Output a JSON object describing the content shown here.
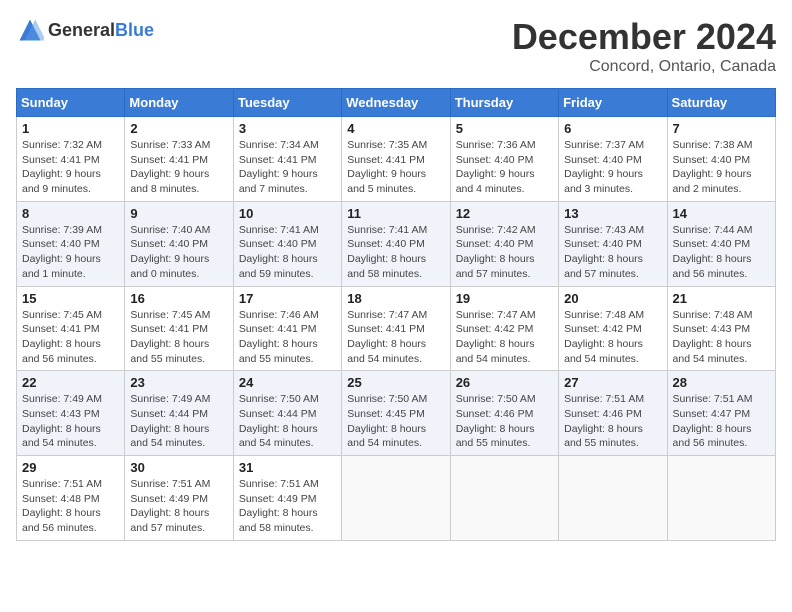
{
  "header": {
    "logo_general": "General",
    "logo_blue": "Blue",
    "month_title": "December 2024",
    "location": "Concord, Ontario, Canada"
  },
  "days_of_week": [
    "Sunday",
    "Monday",
    "Tuesday",
    "Wednesday",
    "Thursday",
    "Friday",
    "Saturday"
  ],
  "weeks": [
    [
      {
        "day": "1",
        "sunrise": "7:32 AM",
        "sunset": "4:41 PM",
        "daylight": "9 hours and 9 minutes."
      },
      {
        "day": "2",
        "sunrise": "7:33 AM",
        "sunset": "4:41 PM",
        "daylight": "9 hours and 8 minutes."
      },
      {
        "day": "3",
        "sunrise": "7:34 AM",
        "sunset": "4:41 PM",
        "daylight": "9 hours and 7 minutes."
      },
      {
        "day": "4",
        "sunrise": "7:35 AM",
        "sunset": "4:41 PM",
        "daylight": "9 hours and 5 minutes."
      },
      {
        "day": "5",
        "sunrise": "7:36 AM",
        "sunset": "4:40 PM",
        "daylight": "9 hours and 4 minutes."
      },
      {
        "day": "6",
        "sunrise": "7:37 AM",
        "sunset": "4:40 PM",
        "daylight": "9 hours and 3 minutes."
      },
      {
        "day": "7",
        "sunrise": "7:38 AM",
        "sunset": "4:40 PM",
        "daylight": "9 hours and 2 minutes."
      }
    ],
    [
      {
        "day": "8",
        "sunrise": "7:39 AM",
        "sunset": "4:40 PM",
        "daylight": "9 hours and 1 minute."
      },
      {
        "day": "9",
        "sunrise": "7:40 AM",
        "sunset": "4:40 PM",
        "daylight": "9 hours and 0 minutes."
      },
      {
        "day": "10",
        "sunrise": "7:41 AM",
        "sunset": "4:40 PM",
        "daylight": "8 hours and 59 minutes."
      },
      {
        "day": "11",
        "sunrise": "7:41 AM",
        "sunset": "4:40 PM",
        "daylight": "8 hours and 58 minutes."
      },
      {
        "day": "12",
        "sunrise": "7:42 AM",
        "sunset": "4:40 PM",
        "daylight": "8 hours and 57 minutes."
      },
      {
        "day": "13",
        "sunrise": "7:43 AM",
        "sunset": "4:40 PM",
        "daylight": "8 hours and 57 minutes."
      },
      {
        "day": "14",
        "sunrise": "7:44 AM",
        "sunset": "4:40 PM",
        "daylight": "8 hours and 56 minutes."
      }
    ],
    [
      {
        "day": "15",
        "sunrise": "7:45 AM",
        "sunset": "4:41 PM",
        "daylight": "8 hours and 56 minutes."
      },
      {
        "day": "16",
        "sunrise": "7:45 AM",
        "sunset": "4:41 PM",
        "daylight": "8 hours and 55 minutes."
      },
      {
        "day": "17",
        "sunrise": "7:46 AM",
        "sunset": "4:41 PM",
        "daylight": "8 hours and 55 minutes."
      },
      {
        "day": "18",
        "sunrise": "7:47 AM",
        "sunset": "4:41 PM",
        "daylight": "8 hours and 54 minutes."
      },
      {
        "day": "19",
        "sunrise": "7:47 AM",
        "sunset": "4:42 PM",
        "daylight": "8 hours and 54 minutes."
      },
      {
        "day": "20",
        "sunrise": "7:48 AM",
        "sunset": "4:42 PM",
        "daylight": "8 hours and 54 minutes."
      },
      {
        "day": "21",
        "sunrise": "7:48 AM",
        "sunset": "4:43 PM",
        "daylight": "8 hours and 54 minutes."
      }
    ],
    [
      {
        "day": "22",
        "sunrise": "7:49 AM",
        "sunset": "4:43 PM",
        "daylight": "8 hours and 54 minutes."
      },
      {
        "day": "23",
        "sunrise": "7:49 AM",
        "sunset": "4:44 PM",
        "daylight": "8 hours and 54 minutes."
      },
      {
        "day": "24",
        "sunrise": "7:50 AM",
        "sunset": "4:44 PM",
        "daylight": "8 hours and 54 minutes."
      },
      {
        "day": "25",
        "sunrise": "7:50 AM",
        "sunset": "4:45 PM",
        "daylight": "8 hours and 54 minutes."
      },
      {
        "day": "26",
        "sunrise": "7:50 AM",
        "sunset": "4:46 PM",
        "daylight": "8 hours and 55 minutes."
      },
      {
        "day": "27",
        "sunrise": "7:51 AM",
        "sunset": "4:46 PM",
        "daylight": "8 hours and 55 minutes."
      },
      {
        "day": "28",
        "sunrise": "7:51 AM",
        "sunset": "4:47 PM",
        "daylight": "8 hours and 56 minutes."
      }
    ],
    [
      {
        "day": "29",
        "sunrise": "7:51 AM",
        "sunset": "4:48 PM",
        "daylight": "8 hours and 56 minutes."
      },
      {
        "day": "30",
        "sunrise": "7:51 AM",
        "sunset": "4:49 PM",
        "daylight": "8 hours and 57 minutes."
      },
      {
        "day": "31",
        "sunrise": "7:51 AM",
        "sunset": "4:49 PM",
        "daylight": "8 hours and 58 minutes."
      },
      null,
      null,
      null,
      null
    ]
  ]
}
